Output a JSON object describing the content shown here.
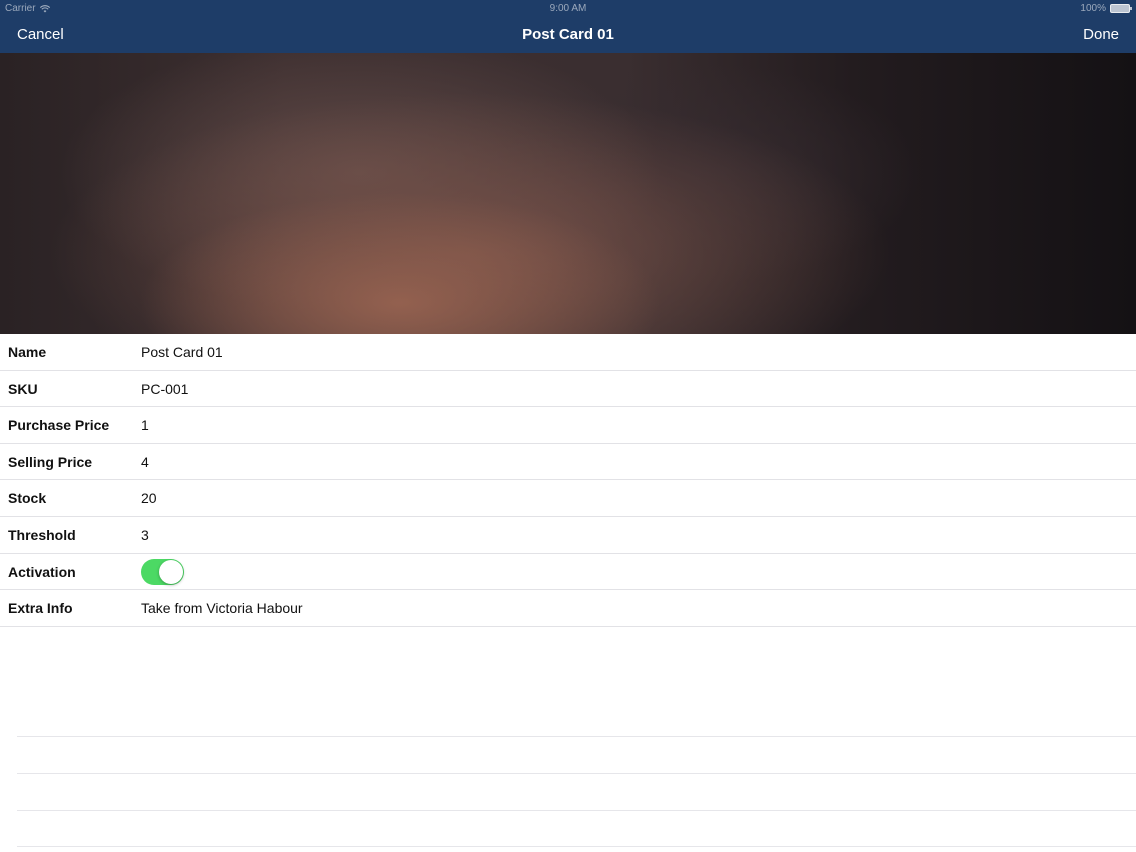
{
  "status_bar": {
    "carrier": "Carrier",
    "time": "9:00 AM",
    "battery": "100%"
  },
  "nav": {
    "cancel_label": "Cancel",
    "title": "Post Card 01",
    "done_label": "Done"
  },
  "photo": {
    "description_icon": "product-photo"
  },
  "fields": {
    "name": {
      "label": "Name",
      "value": "Post Card 01"
    },
    "sku": {
      "label": "SKU",
      "value": "PC-001"
    },
    "purchase_price": {
      "label": "Purchase Price",
      "value": "1"
    },
    "selling_price": {
      "label": "Selling Price",
      "value": "4"
    },
    "stock": {
      "label": "Stock",
      "value": "20"
    },
    "threshold": {
      "label": "Threshold",
      "value": "3"
    },
    "activation": {
      "label": "Activation",
      "on": true
    },
    "extra_info": {
      "label": "Extra Info",
      "value": "Take from Victoria Habour"
    }
  },
  "colors": {
    "nav_background": "#1e3d68",
    "toggle_on": "#4cd964"
  }
}
